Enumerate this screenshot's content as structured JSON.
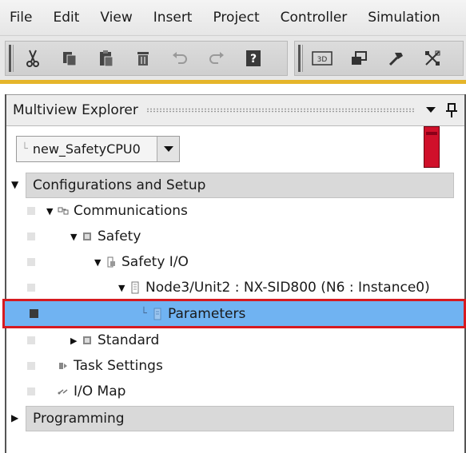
{
  "menu": {
    "items": [
      "File",
      "Edit",
      "View",
      "Insert",
      "Project",
      "Controller",
      "Simulation"
    ]
  },
  "toolbar": {
    "group1": [
      "cut-icon",
      "copy-icon",
      "paste-icon",
      "delete-icon",
      "undo-icon",
      "redo-icon",
      "help-icon"
    ],
    "group2": [
      "3d-view-icon",
      "window-icon",
      "build-icon",
      "transfer-icon"
    ],
    "accent_color": "#e5b52a"
  },
  "explorer": {
    "title": "Multiview Explorer",
    "device": "new_SafetyCPU0",
    "status_color": "#d0102a",
    "sections": {
      "config": "Configurations and Setup",
      "programming": "Programming"
    },
    "tree": {
      "communications": "Communications",
      "safety": "Safety",
      "safety_io": "Safety I/O",
      "node": "Node3/Unit2 : NX-SID800 (N6 : Instance0)",
      "parameters": "Parameters",
      "standard": "Standard",
      "task_settings": "Task Settings",
      "io_map": "I/O Map"
    },
    "selection_color": "#70b3f2",
    "highlight_color": "#d61a20"
  }
}
